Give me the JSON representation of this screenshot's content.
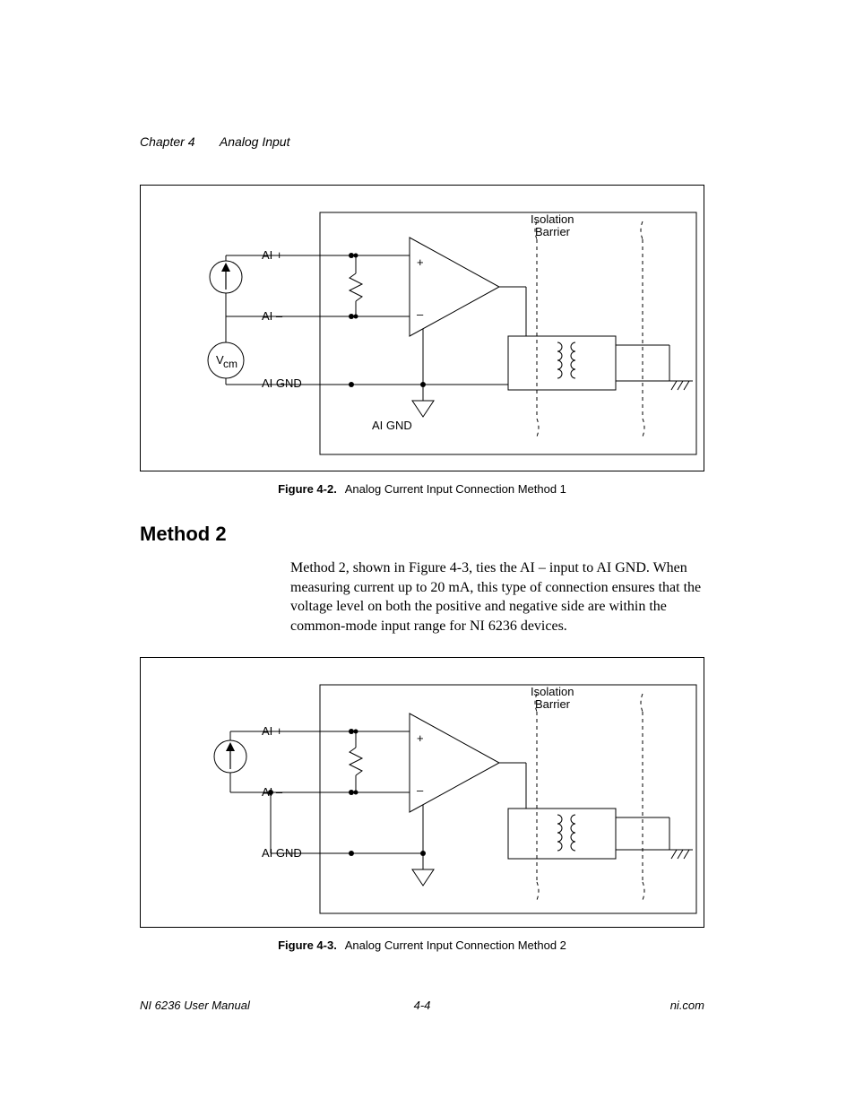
{
  "header": {
    "chapter_label": "Chapter 4",
    "chapter_title": "Analog Input"
  },
  "figure1": {
    "caption_label": "Figure 4-2.",
    "caption_text": "Analog Current Input Connection Method 1",
    "labels": {
      "ai_plus": "AI +",
      "ai_minus": "AI –",
      "ai_gnd": "AI GND",
      "ai_gnd2": "AI GND",
      "vcm": "V",
      "vcm_sub": "cm",
      "isolation1": "Isolation",
      "isolation2": "Barrier",
      "plus": "+",
      "minus": "–"
    }
  },
  "section": {
    "heading": "Method 2",
    "body": "Method 2, shown in Figure 4-3, ties the AI – input to AI GND. When measuring current up to 20 mA, this type of connection ensures that the voltage level on both the positive and negative side are within the common-mode input range for NI 6236 devices."
  },
  "figure2": {
    "caption_label": "Figure 4-3.",
    "caption_text": "Analog Current Input Connection Method 2",
    "labels": {
      "ai_plus": "AI +",
      "ai_minus": "AI –",
      "ai_gnd": "AI GND",
      "isolation1": "Isolation",
      "isolation2": "Barrier",
      "plus": "+",
      "minus": "–"
    }
  },
  "footer": {
    "left": "NI 6236 User Manual",
    "mid": "4-4",
    "right": "ni.com"
  }
}
